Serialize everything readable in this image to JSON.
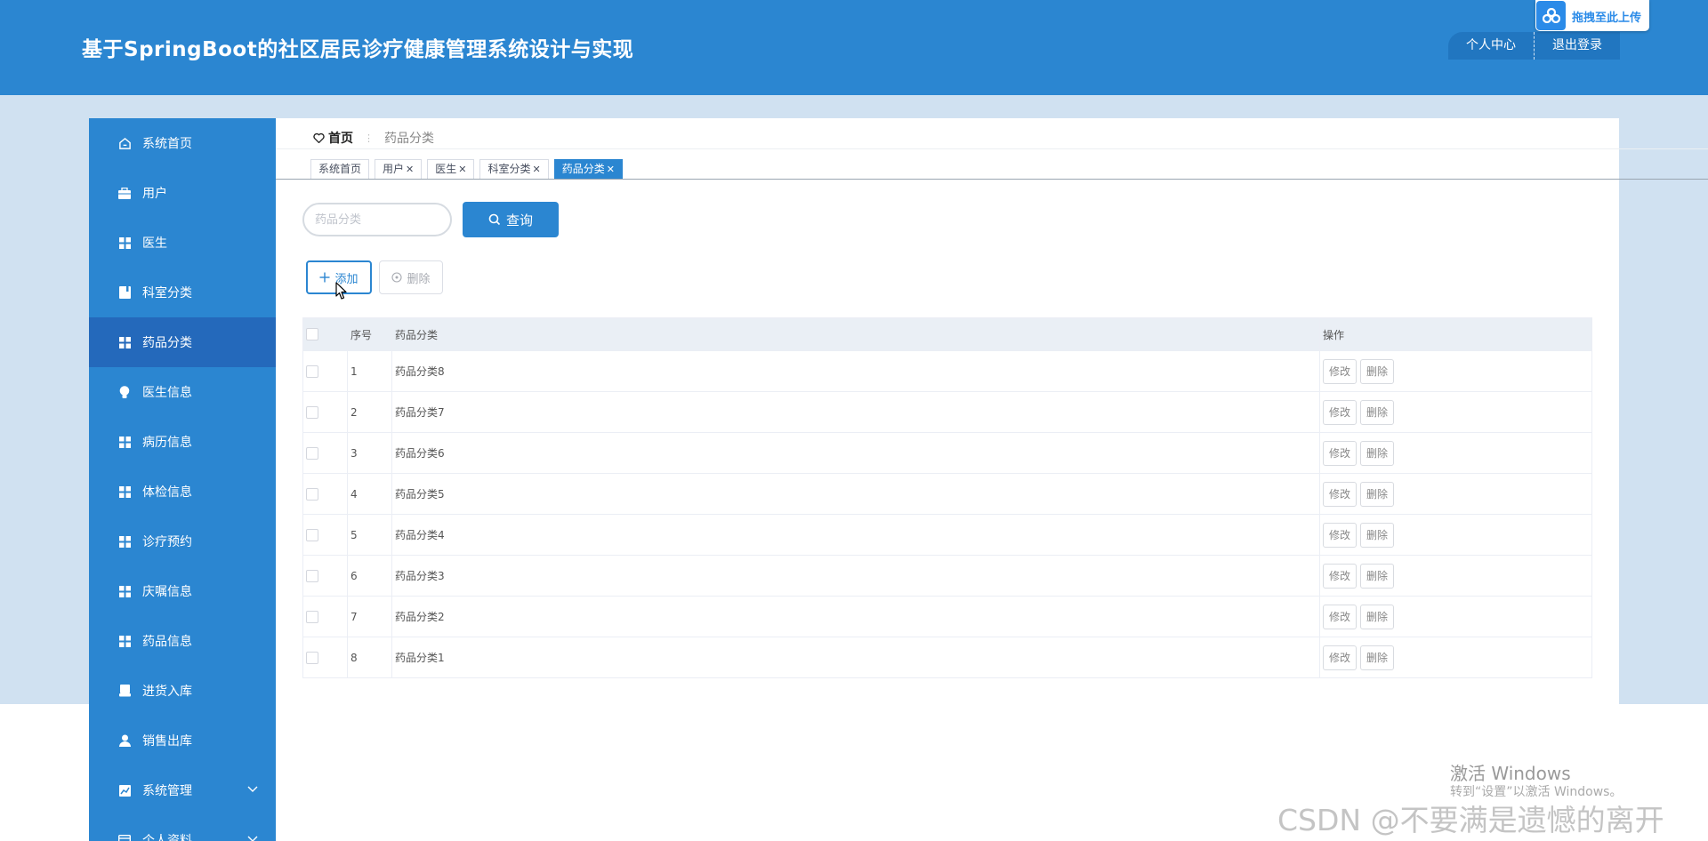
{
  "app": {
    "title": "基于SpringBoot的社区居民诊疗健康管理系统设计与实现"
  },
  "header": {
    "user_center": "个人中心",
    "logout": "退出登录"
  },
  "baidu_widget": {
    "label": "拖拽至此上传"
  },
  "sidebar": {
    "items": [
      {
        "label": "系统首页",
        "icon": "home-icon"
      },
      {
        "label": "用户",
        "icon": "briefcase-icon"
      },
      {
        "label": "医生",
        "icon": "grid-icon"
      },
      {
        "label": "科室分类",
        "icon": "book-icon"
      },
      {
        "label": "药品分类",
        "icon": "grid-icon",
        "active": true
      },
      {
        "label": "医生信息",
        "icon": "bulb-icon"
      },
      {
        "label": "病历信息",
        "icon": "grid-icon"
      },
      {
        "label": "体检信息",
        "icon": "grid-icon"
      },
      {
        "label": "诊疗预约",
        "icon": "grid-icon"
      },
      {
        "label": "庆嘱信息",
        "icon": "grid-icon"
      },
      {
        "label": "药品信息",
        "icon": "grid-icon"
      },
      {
        "label": "进货入库",
        "icon": "printer-icon"
      },
      {
        "label": "销售出库",
        "icon": "user-icon"
      },
      {
        "label": "系统管理",
        "icon": "chart-icon",
        "expandable": true
      },
      {
        "label": "个人资料",
        "icon": "card-icon",
        "expandable": true
      }
    ]
  },
  "breadcrumb": {
    "home": "首页",
    "current": "药品分类"
  },
  "tabs": [
    {
      "label": "系统首页",
      "closable": false
    },
    {
      "label": "用户",
      "closable": true
    },
    {
      "label": "医生",
      "closable": true
    },
    {
      "label": "科室分类",
      "closable": true
    },
    {
      "label": "药品分类",
      "closable": true,
      "active": true
    }
  ],
  "search": {
    "placeholder": "药品分类",
    "value": "",
    "query_label": "查询"
  },
  "actions": {
    "add_label": "添加",
    "delete_label": "删除"
  },
  "table": {
    "headers": [
      "序号",
      "药品分类",
      "操作"
    ],
    "rows": [
      {
        "index": "1",
        "name": "药品分类8"
      },
      {
        "index": "2",
        "name": "药品分类7"
      },
      {
        "index": "3",
        "name": "药品分类6"
      },
      {
        "index": "4",
        "name": "药品分类5"
      },
      {
        "index": "5",
        "name": "药品分类4"
      },
      {
        "index": "6",
        "name": "药品分类3"
      },
      {
        "index": "7",
        "name": "药品分类2"
      },
      {
        "index": "8",
        "name": "药品分类1"
      }
    ],
    "edit_label": "修改",
    "delete_label": "删除"
  },
  "overlay": {
    "activate_windows": "激活 Windows",
    "activate_hint": "转到“设置”以激活 Windows。",
    "csdn": "CSDN @不要满是遗憾的离开"
  },
  "colors": {
    "primary": "#2b86d1",
    "active_nav": "#2469bb",
    "background": "#d0e1f1"
  }
}
